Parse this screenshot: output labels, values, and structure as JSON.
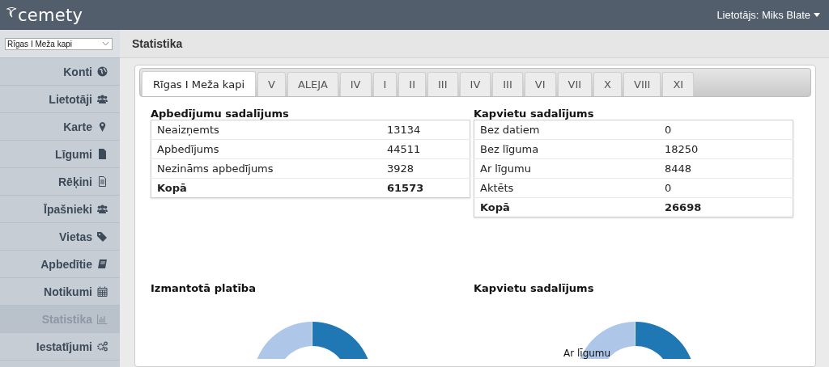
{
  "header": {
    "logo": "cemety",
    "user": "Lietotājs: Miks Blate"
  },
  "sidebar": {
    "cemetery_select": {
      "value": "Rīgas I Meža kapi"
    },
    "items": [
      {
        "label": "Konti",
        "selected": false
      },
      {
        "label": "Lietotāji",
        "selected": false
      },
      {
        "label": "Karte",
        "selected": false
      },
      {
        "label": "Līgumi",
        "selected": false
      },
      {
        "label": "Rēķini",
        "selected": false
      },
      {
        "label": "Īpašnieki",
        "selected": false
      },
      {
        "label": "Vietas",
        "selected": false
      },
      {
        "label": "Apbedītie",
        "selected": false
      },
      {
        "label": "Notikumi",
        "selected": false
      },
      {
        "label": "Statistika",
        "selected": true
      },
      {
        "label": "Iestatījumi",
        "selected": false
      }
    ]
  },
  "page_title": "Statistika",
  "tabs": [
    {
      "label": "Rīgas I Meža kapi",
      "selected": true
    },
    {
      "label": "V",
      "selected": false
    },
    {
      "label": "ALEJA",
      "selected": false
    },
    {
      "label": "IV",
      "selected": false
    },
    {
      "label": "I",
      "selected": false
    },
    {
      "label": "II",
      "selected": false
    },
    {
      "label": "III",
      "selected": false
    },
    {
      "label": "IV",
      "selected": false
    },
    {
      "label": "III",
      "selected": false
    },
    {
      "label": "VI",
      "selected": false
    },
    {
      "label": "VII",
      "selected": false
    },
    {
      "label": "X",
      "selected": false
    },
    {
      "label": "VIII",
      "selected": false
    },
    {
      "label": "XI",
      "selected": false
    }
  ],
  "tables": [
    {
      "title": "Apbedījumu sadalījums",
      "rows": [
        {
          "label": "Neaizņemts",
          "value": "13134",
          "kind": "row"
        },
        {
          "label": "Apbedījums",
          "value": "44511",
          "kind": "row"
        },
        {
          "label": "Nezināms apbedījums",
          "value": "3928",
          "kind": "row"
        },
        {
          "label": "Kopā",
          "value": "61573",
          "kind": "total"
        }
      ]
    },
    {
      "title": "Kapvietu sadalījums",
      "rows": [
        {
          "label": "Bez datiem",
          "value": "0",
          "kind": "row"
        },
        {
          "label": "Bez līguma",
          "value": "18250",
          "kind": "row"
        },
        {
          "label": "Ar līgumu",
          "value": "8448",
          "kind": "row"
        },
        {
          "label": "Aktēts",
          "value": "0",
          "kind": "row"
        },
        {
          "label": "Kopā",
          "value": "26698",
          "kind": "total"
        }
      ]
    }
  ],
  "charts": [
    {
      "title": "Izmantotā platība"
    },
    {
      "title": "Kapvietu sadalījums",
      "labels": [
        "Ar līgumu"
      ]
    }
  ]
}
